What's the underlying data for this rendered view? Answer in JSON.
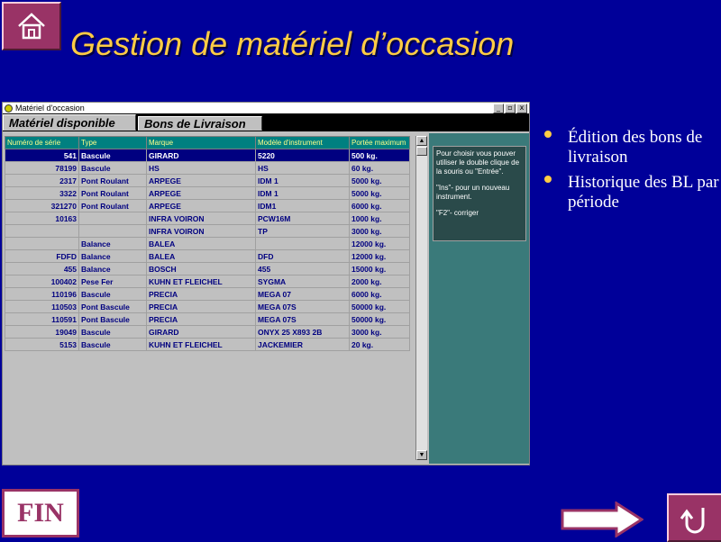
{
  "slide": {
    "title": "Gestion de matériel d’occasion",
    "fin_label": "FIN"
  },
  "window": {
    "title": "Matériel d'occasion",
    "controls": [
      "_",
      "▫",
      "x"
    ]
  },
  "tabs": [
    {
      "label": "Matériel disponible",
      "active": true
    },
    {
      "label": "Bons de Livraison",
      "active": false
    }
  ],
  "grid": {
    "columns": [
      "Numéro de série",
      "Type",
      "Marque",
      "Modèle d'instrument",
      "Portée maximum"
    ],
    "selected_row": 0,
    "rows": [
      [
        "541",
        "Bascule",
        "GIRARD",
        "5220",
        "500 kg."
      ],
      [
        "78199",
        "Bascule",
        "HS",
        "HS",
        "60 kg."
      ],
      [
        "2317",
        "Pont Roulant",
        "ARPEGE",
        "IDM 1",
        "5000 kg."
      ],
      [
        "3322",
        "Pont Roulant",
        "ARPEGE",
        "IDM 1",
        "5000 kg."
      ],
      [
        "321270",
        "Pont Roulant",
        "ARPEGE",
        "IDM1",
        "6000 kg."
      ],
      [
        "10163",
        "",
        "INFRA VOIRON",
        "PCW16M",
        "1000 kg."
      ],
      [
        "",
        "",
        "INFRA VOIRON",
        "TP",
        "3000 kg."
      ],
      [
        "",
        "Balance",
        "BALEA",
        "",
        "12000 kg."
      ],
      [
        "FDFD",
        "Balance",
        "BALEA",
        "DFD",
        "12000 kg."
      ],
      [
        "455",
        "Balance",
        "BOSCH",
        "455",
        "15000 kg."
      ],
      [
        "100402",
        "Pese Fer",
        "KUHN ET FLEICHEL",
        "SYGMA",
        "2000 kg."
      ],
      [
        "110196",
        "Bascule",
        "PRECIA",
        "MEGA 07",
        "6000 kg."
      ],
      [
        "110503",
        "Pont Bascule",
        "PRECIA",
        "MEGA 07S",
        "50000 kg."
      ],
      [
        "110591",
        "Pont Bascule",
        "PRECIA",
        "MEGA 07S",
        "50000 kg."
      ],
      [
        "19049",
        "Bascule",
        "GIRARD",
        "ONYX 25 X893 2B",
        "3000 kg."
      ],
      [
        "5153",
        "Bascule",
        "KUHN ET FLEICHEL",
        "JACKEMIER",
        "20 kg."
      ]
    ]
  },
  "help": {
    "lines": [
      "Pour choisir vous pouver utiliser le double clique de la souris ou \"Entrée\".",
      "\"Ins\"- pour un nouveau instrument.",
      "\"F2\"- corriger"
    ]
  },
  "bullets": [
    "Édition des bons de livraison",
    "Historique des BL par période"
  ],
  "colors": {
    "background": "#000099",
    "title": "#ffcc44",
    "accent": "#993366",
    "grid_header": "#008080",
    "selected_row": "#000080"
  },
  "icons": {
    "home": "home-icon",
    "next": "arrow-right-icon",
    "return": "u-turn-icon"
  }
}
